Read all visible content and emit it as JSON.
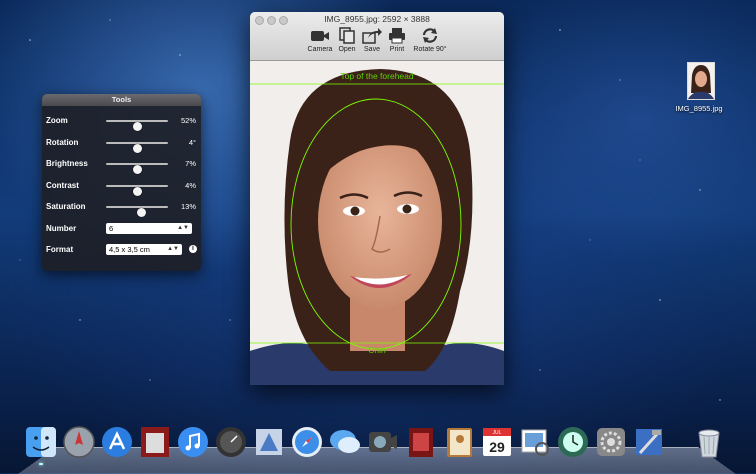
{
  "tools": {
    "title": "Tools",
    "sliders": [
      {
        "label": "Zoom",
        "value": "52%",
        "level": 0.5
      },
      {
        "label": "Rotation",
        "value": "4°",
        "level": 0.5
      },
      {
        "label": "Brightness",
        "value": "7%",
        "level": 0.5
      },
      {
        "label": "Contrast",
        "value": "4%",
        "level": 0.5
      },
      {
        "label": "Saturation",
        "value": "13%",
        "level": 0.56
      }
    ],
    "number": {
      "label": "Number",
      "value": "6"
    },
    "format": {
      "label": "Format",
      "value": "4,5 x 3,5 cm"
    }
  },
  "window": {
    "title": "IMG_8955.jpg: 2592 × 3888",
    "toolbar": [
      {
        "label": "Camera",
        "icon": "camera-icon"
      },
      {
        "label": "Open",
        "icon": "open-icon"
      },
      {
        "label": "Save",
        "icon": "save-icon"
      },
      {
        "label": "Print",
        "icon": "print-icon"
      },
      {
        "label": "Rotate 90°",
        "icon": "rotate-icon"
      }
    ],
    "guides": {
      "top_label": "Top of the forehead",
      "bottom_label": "Chin",
      "color": "#7CFC00"
    }
  },
  "desktop_file": {
    "name": "IMG_8955.jpg"
  },
  "dock": {
    "items": [
      {
        "name": "finder",
        "running": true
      },
      {
        "name": "launchpad",
        "running": false
      },
      {
        "name": "app-store",
        "running": false
      },
      {
        "name": "photo-booth",
        "running": false
      },
      {
        "name": "itunes",
        "running": false
      },
      {
        "name": "dashboard",
        "running": false
      },
      {
        "name": "mail",
        "running": false
      },
      {
        "name": "safari",
        "running": false
      },
      {
        "name": "messages",
        "running": false
      },
      {
        "name": "facetime",
        "running": false
      },
      {
        "name": "photo-booth-2",
        "running": false
      },
      {
        "name": "contacts",
        "running": false
      },
      {
        "name": "calendar",
        "running": false
      },
      {
        "name": "preview",
        "running": false
      },
      {
        "name": "time-machine",
        "running": false
      },
      {
        "name": "system-preferences",
        "running": false
      },
      {
        "name": "xcode",
        "running": false
      },
      {
        "name": "trash",
        "running": false
      }
    ],
    "calendar_day": "29",
    "calendar_month": "JUL"
  }
}
